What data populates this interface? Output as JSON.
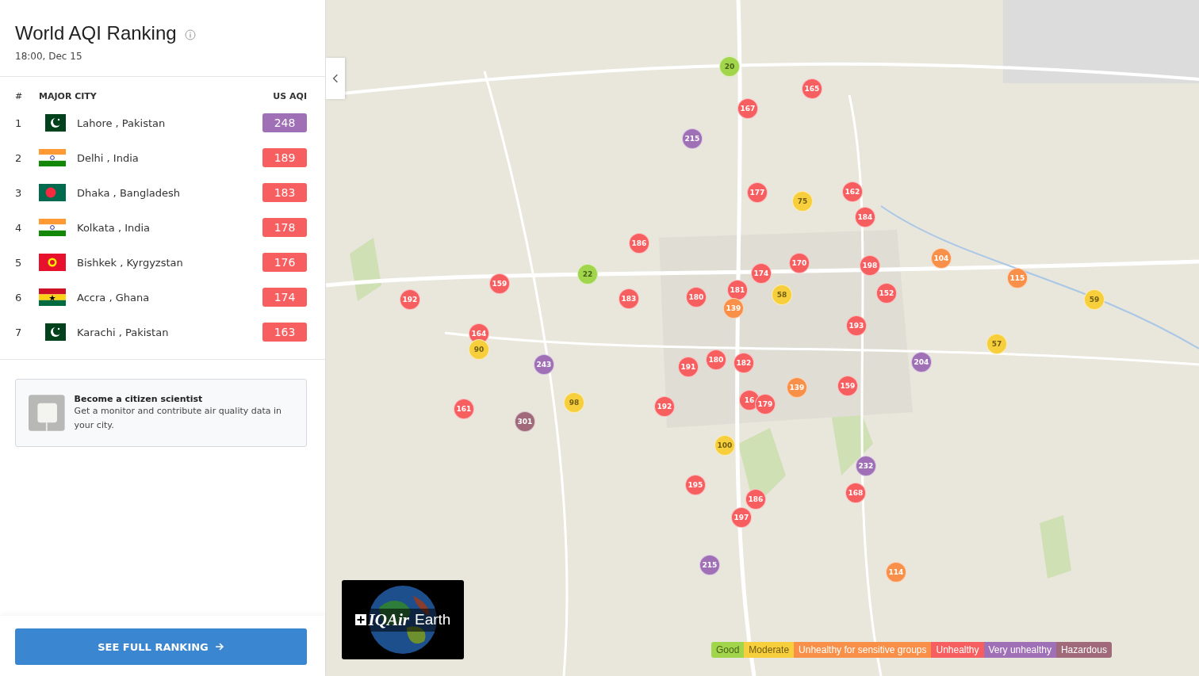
{
  "header": {
    "title": "World AQI Ranking",
    "time": "18:00, Dec 15"
  },
  "ranking": {
    "columns": [
      "#",
      "MAJOR CITY",
      "US AQI"
    ],
    "rows": [
      {
        "rank": "1",
        "flag": {
          "kind": "pakistan"
        },
        "city": "Lahore , Pakistan",
        "aqi": "248",
        "color": "#a070b6"
      },
      {
        "rank": "2",
        "flag": {
          "kind": "india"
        },
        "city": "Delhi , India",
        "aqi": "189",
        "color": "#f65e5f"
      },
      {
        "rank": "3",
        "flag": {
          "kind": "bangladesh"
        },
        "city": "Dhaka , Bangladesh",
        "aqi": "183",
        "color": "#f65e5f"
      },
      {
        "rank": "4",
        "flag": {
          "kind": "india"
        },
        "city": "Kolkata , India",
        "aqi": "178",
        "color": "#f65e5f"
      },
      {
        "rank": "5",
        "flag": {
          "kind": "kyrgyzstan"
        },
        "city": "Bishkek , Kyrgyzstan",
        "aqi": "176",
        "color": "#f65e5f"
      },
      {
        "rank": "6",
        "flag": {
          "kind": "ghana"
        },
        "city": "Accra , Ghana",
        "aqi": "174",
        "color": "#f65e5f"
      },
      {
        "rank": "7",
        "flag": {
          "kind": "pakistan"
        },
        "city": "Karachi , Pakistan",
        "aqi": "163",
        "color": "#f65e5f"
      }
    ]
  },
  "promo": {
    "title": "Become a citizen scientist",
    "text": "Get a monitor and contribute air quality data in your city."
  },
  "full_ranking_button": {
    "label": "SEE FULL RANKING"
  },
  "map": {
    "markers": [
      {
        "value": "20",
        "color": "#a1d64c"
      },
      {
        "value": "165",
        "color": "#f65e5f"
      },
      {
        "value": "167",
        "color": "#f65e5f"
      },
      {
        "value": "215",
        "color": "#a070b6"
      },
      {
        "value": "162",
        "color": "#f65e5f"
      },
      {
        "value": "177",
        "color": "#f65e5f"
      },
      {
        "value": "75",
        "color": "#f7cf3d"
      },
      {
        "value": "184",
        "color": "#f65e5f"
      },
      {
        "value": "186",
        "color": "#f65e5f"
      },
      {
        "value": "104",
        "color": "#f99049"
      },
      {
        "value": "170",
        "color": "#f65e5f"
      },
      {
        "value": "198",
        "color": "#f65e5f"
      },
      {
        "value": "174",
        "color": "#f65e5f"
      },
      {
        "value": "22",
        "color": "#a1d64c"
      },
      {
        "value": "115",
        "color": "#f99049"
      },
      {
        "value": "159",
        "color": "#f65e5f"
      },
      {
        "value": "181",
        "color": "#f65e5f"
      },
      {
        "value": "152",
        "color": "#f65e5f"
      },
      {
        "value": "192",
        "color": "#f65e5f"
      },
      {
        "value": "183",
        "color": "#f65e5f"
      },
      {
        "value": "180",
        "color": "#f65e5f"
      },
      {
        "value": "58",
        "color": "#f7cf3d"
      },
      {
        "value": "59",
        "color": "#f7cf3d"
      },
      {
        "value": "139",
        "color": "#f99049"
      },
      {
        "value": "193",
        "color": "#f65e5f"
      },
      {
        "value": "164",
        "color": "#f65e5f"
      },
      {
        "value": "57",
        "color": "#f7cf3d"
      },
      {
        "value": "90",
        "color": "#f7cf3d"
      },
      {
        "value": "180",
        "color": "#f65e5f"
      },
      {
        "value": "182",
        "color": "#f65e5f"
      },
      {
        "value": "204",
        "color": "#a070b6"
      },
      {
        "value": "243",
        "color": "#a070b6"
      },
      {
        "value": "191",
        "color": "#f65e5f"
      },
      {
        "value": "159",
        "color": "#f65e5f"
      },
      {
        "value": "139",
        "color": "#f99049"
      },
      {
        "value": "16",
        "color": "#f65e5f"
      },
      {
        "value": "98",
        "color": "#f7cf3d"
      },
      {
        "value": "179",
        "color": "#f65e5f"
      },
      {
        "value": "192",
        "color": "#f65e5f"
      },
      {
        "value": "161",
        "color": "#f65e5f"
      },
      {
        "value": "301",
        "color": "#a06a7b"
      },
      {
        "value": "100",
        "color": "#f7cf3d"
      },
      {
        "value": "232",
        "color": "#a070b6"
      },
      {
        "value": "195",
        "color": "#f65e5f"
      },
      {
        "value": "168",
        "color": "#f65e5f"
      },
      {
        "value": "186",
        "color": "#f65e5f"
      },
      {
        "value": "197",
        "color": "#f65e5f"
      },
      {
        "value": "215",
        "color": "#a070b6"
      },
      {
        "value": "114",
        "color": "#f99049"
      }
    ]
  },
  "logo": {
    "brand": "IQAir",
    "product": "Earth"
  },
  "legend": [
    {
      "label": "Good",
      "color": "#a1d64c"
    },
    {
      "label": "Moderate",
      "color": "#f7cf3d"
    },
    {
      "label": "Unhealthy for sensitive groups",
      "color": "#f99049"
    },
    {
      "label": "Unhealthy",
      "color": "#f65e5f"
    },
    {
      "label": "Very unhealthy",
      "color": "#a070b6"
    },
    {
      "label": "Hazardous",
      "color": "#a06a7b"
    }
  ]
}
